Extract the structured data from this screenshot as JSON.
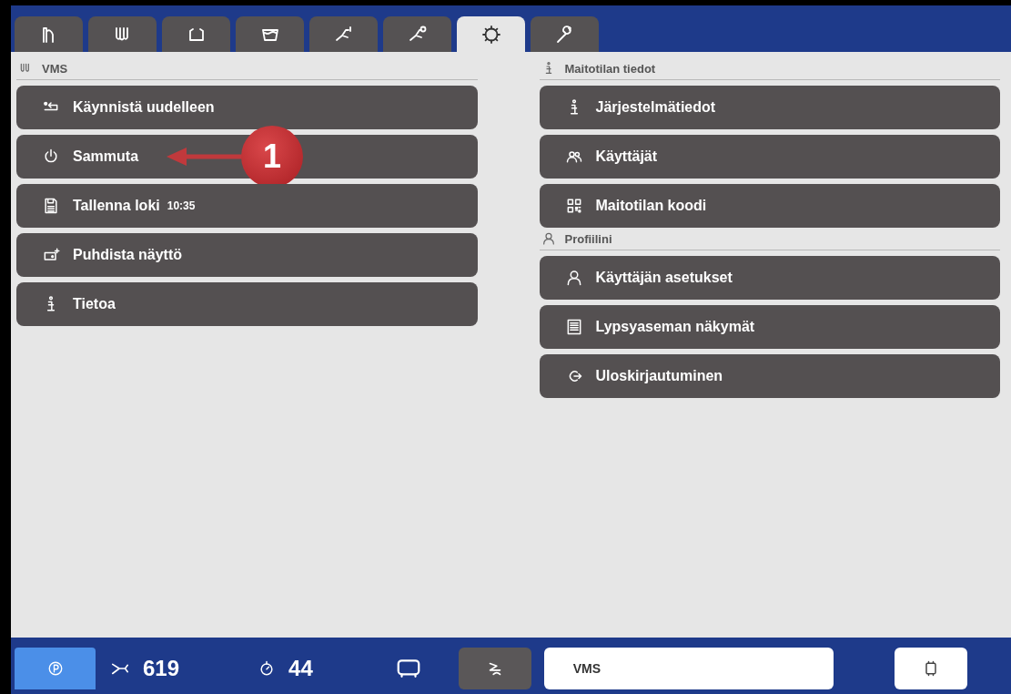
{
  "tabs": [
    {
      "selected": false
    },
    {
      "selected": false
    },
    {
      "selected": false
    },
    {
      "selected": false
    },
    {
      "selected": false
    },
    {
      "selected": false
    },
    {
      "selected": true
    },
    {
      "selected": false
    }
  ],
  "columns": [
    {
      "sections": [
        {
          "title": "VMS",
          "items": [
            {
              "label": "Käynnistä uudelleen"
            },
            {
              "label": "Sammuta",
              "callout": "1"
            },
            {
              "label": "Tallenna loki",
              "detail": "10:35"
            },
            {
              "label": "Puhdista näyttö"
            },
            {
              "label": "Tietoa"
            }
          ]
        }
      ]
    },
    {
      "sections": [
        {
          "title": "Maitotilan tiedot",
          "items": [
            {
              "label": "Järjestelmätiedot"
            },
            {
              "label": "Käyttäjät"
            },
            {
              "label": "Maitotilan koodi"
            }
          ]
        },
        {
          "title": "Profiilini",
          "items": [
            {
              "label": "Käyttäjän asetukset"
            },
            {
              "label": "Lypsyaseman näkymät"
            },
            {
              "label": "Uloskirjautuminen"
            }
          ]
        }
      ]
    }
  ],
  "status_bar": {
    "count_1": "619",
    "count_2": "44",
    "field_value": "VMS"
  }
}
